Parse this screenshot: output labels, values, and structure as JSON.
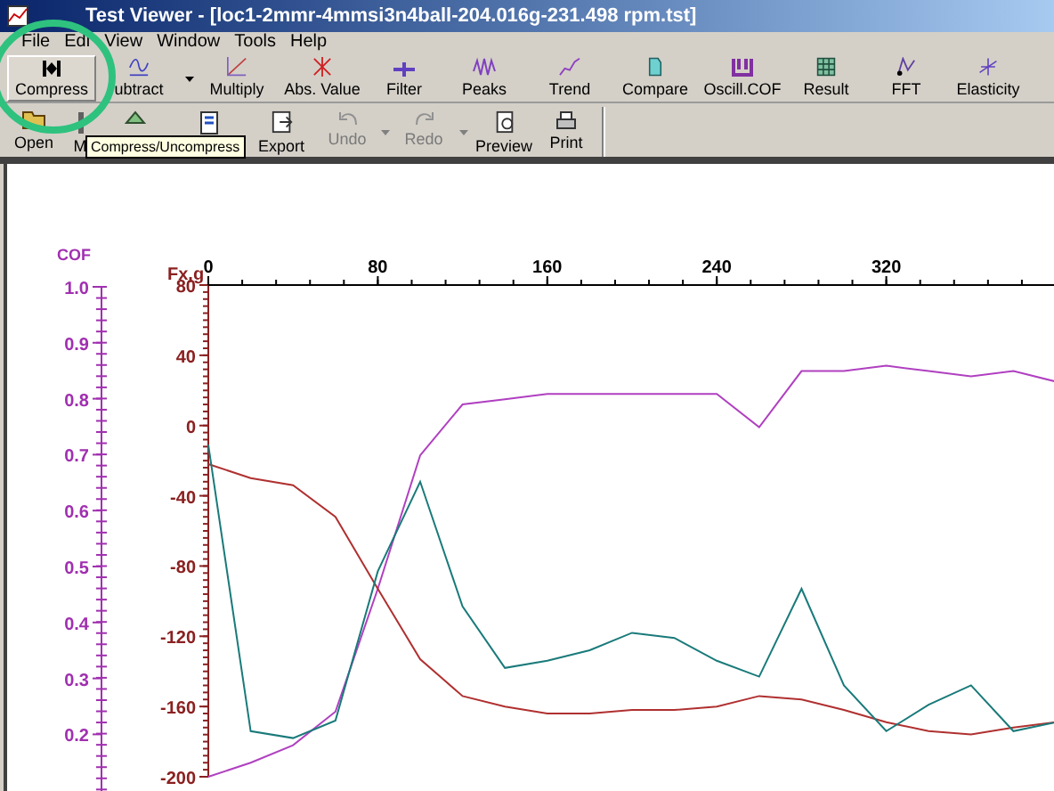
{
  "window": {
    "title": "Test Viewer - [loc1-2mmr-4mmsi3n4ball-204.016g-231.498 rpm.tst]"
  },
  "menu": [
    "File",
    "Edi",
    "View",
    "Window",
    "Tools",
    "Help"
  ],
  "toolbar": [
    {
      "label": "Compress",
      "pressed": true,
      "dropdown": false
    },
    {
      "label": "ubtract",
      "pressed": false,
      "dropdown": true
    },
    {
      "label": "Multiply",
      "pressed": false,
      "dropdown": false
    },
    {
      "label": "Abs. Value",
      "pressed": false,
      "dropdown": false
    },
    {
      "label": "Filter",
      "pressed": false,
      "dropdown": false
    },
    {
      "label": "Peaks",
      "pressed": false,
      "dropdown": false
    },
    {
      "label": "Trend",
      "pressed": false,
      "dropdown": false
    },
    {
      "label": "Compare",
      "pressed": false,
      "dropdown": false
    },
    {
      "label": "Oscill.COF",
      "pressed": false,
      "dropdown": false
    },
    {
      "label": "Result",
      "pressed": false,
      "dropdown": false
    },
    {
      "label": "FFT",
      "pressed": false,
      "dropdown": false
    },
    {
      "label": "Elasticity",
      "pressed": false,
      "dropdown": false
    }
  ],
  "toolbar2": [
    {
      "label": "Open",
      "disabled": false,
      "dropdown": false
    },
    {
      "label": "M",
      "disabled": false,
      "dropdown": false
    },
    {
      "disabled": false,
      "dropdown": false
    },
    {
      "disabled": false,
      "dropdown": false
    },
    {
      "label": "Export",
      "disabled": false,
      "dropdown": false
    },
    {
      "label": "Undo",
      "disabled": true,
      "dropdown": true
    },
    {
      "label": "Redo",
      "disabled": true,
      "dropdown": true
    },
    {
      "label": "Preview",
      "disabled": false,
      "dropdown": false
    },
    {
      "label": "Print",
      "disabled": false,
      "dropdown": false
    }
  ],
  "tooltip": "Compress/Uncompress",
  "chart": {
    "chart_data": {
      "type": "line",
      "ylabel": "Fx,g",
      "x": [
        0,
        20,
        40,
        60,
        80,
        100,
        120,
        140,
        160,
        180,
        200,
        220,
        240,
        260,
        280,
        300,
        320,
        340,
        360,
        380,
        400
      ],
      "xlim": [
        0,
        400
      ],
      "ylim": [
        -200,
        80
      ],
      "xticks": [
        0,
        80,
        160,
        240,
        320
      ],
      "yticks": [
        80,
        40,
        0,
        -40,
        -80,
        -120,
        -160,
        -200
      ],
      "series": [
        {
          "color": "#b040c0",
          "values": [
            -200,
            -192,
            -182,
            -163,
            -93,
            -17,
            12,
            15,
            18,
            18,
            18,
            18,
            18,
            -1,
            31,
            31,
            34,
            31,
            28,
            31,
            25
          ]
        },
        {
          "color": "#b03030",
          "values": [
            -22,
            -30,
            -34,
            -52,
            -93,
            -133,
            -154,
            -160,
            -164,
            -164,
            -162,
            -162,
            -160,
            -154,
            -156,
            -162,
            -169,
            -174,
            -176,
            -172,
            -169
          ]
        },
        {
          "color": "#1a7a7a",
          "values": [
            -11,
            -174,
            -178,
            -168,
            -83,
            -32,
            -103,
            -138,
            -134,
            -128,
            -118,
            -121,
            -134,
            -143,
            -93,
            -148,
            -174,
            -159,
            -148,
            -174,
            -169
          ]
        }
      ]
    }
  },
  "cof_axis": {
    "title": "COF",
    "ticks": [
      "1.0",
      "0.9",
      "0.8",
      "0.7",
      "0.6",
      "0.5",
      "0.4",
      "0.3",
      "0.2"
    ]
  }
}
